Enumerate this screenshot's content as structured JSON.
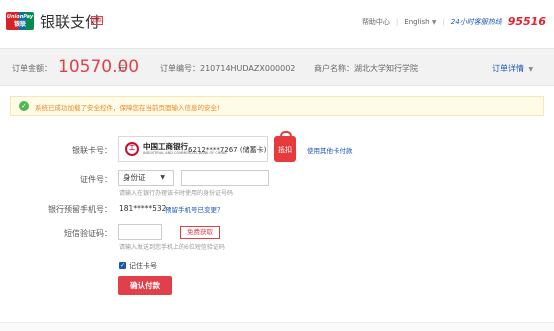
{
  "header": {
    "logo_en": "UnionPay",
    "logo_zh": "银联",
    "brand_title": "银联支付",
    "brand_sub": "银联",
    "help": "帮助中心",
    "language": "English",
    "hotline_label": "24小时客服热线",
    "hotline_number": "95516"
  },
  "order": {
    "amount_label": "订单金额：",
    "amount_value": "10570.00",
    "amount_unit": "元",
    "order_no": "订单编号：210714HUDAZX000002",
    "merchant": "商户名称：湖北大学知行学院",
    "detail_link": "订单详情"
  },
  "notice": {
    "text": "系统已成功加载了安全控件，保障您在当前页面输入信息的安全！"
  },
  "form": {
    "card_label": "银联卡号：",
    "bank_name": "中国工商银行",
    "bank_name_en": "INDUSTRIAL AND COMMERCIAL BANK OF CHINA",
    "card_number": "6212****7267 (储蓄卡)",
    "discount_tag": "抵扣",
    "other_card_link": "使用其他卡付款",
    "id_label": "证件号：",
    "id_type": "身份证",
    "id_value": "",
    "id_hint": "请输入在银行办理该卡时使用的身份证号码",
    "phone_label": "银行预留手机号：",
    "phone_value": "181*****532",
    "phone_change_link": "预留手机号已变更？",
    "sms_label": "短信验证码：",
    "sms_value": "",
    "sms_button": "免费获取",
    "sms_hint": "请输入发送到您手机上的6位短信验证码",
    "remember_label": "记住卡号",
    "remember_checked": true,
    "pay_button": "确认付款"
  },
  "colors": {
    "accent_red": "#e1404a",
    "link_blue": "#1a55b5",
    "notice_bg": "#fffbe6"
  }
}
